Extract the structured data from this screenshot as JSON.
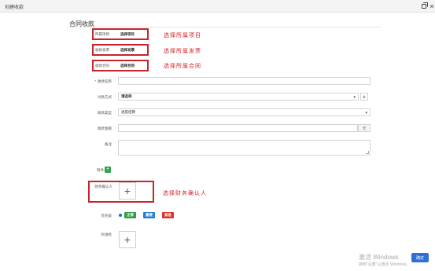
{
  "window": {
    "title": "创建收款"
  },
  "section_title": "合同收款",
  "highlight_color": "#c7242b",
  "picks": [
    {
      "label": "所属项目",
      "value": "选择项目",
      "annotation": "选择所属项目"
    },
    {
      "label": "收款发票",
      "value": "选择发票",
      "annotation": "选择所属发票"
    },
    {
      "label": "收款合同",
      "value": "选择合同",
      "annotation": "选择所属合同"
    }
  ],
  "form": {
    "name_label": "收款名称",
    "name_value": "",
    "payment_method_label": "付款方式",
    "payment_method_value": "请选择",
    "type_label": "收款类型",
    "type_value": "进度结算",
    "amount_label": "收款金额",
    "amount_unit": "元",
    "remark_label": "备注",
    "attachment_label": "附件",
    "finance_label": "财务确认人",
    "finance_annotation": "选择财务确认人",
    "priority_label": "优先级",
    "priority_options": [
      {
        "label": "正常",
        "color": "#2e9e44"
      },
      {
        "label": "重要",
        "color": "#2b7bd6"
      },
      {
        "label": "紧急",
        "color": "#d9342b"
      }
    ],
    "cc_label": "抄送给"
  },
  "footer": {
    "watermark_line1": "激活 Windows",
    "watermark_line2": "转到\"设置\"以激活 Windows。",
    "confirm_label": "确定"
  }
}
